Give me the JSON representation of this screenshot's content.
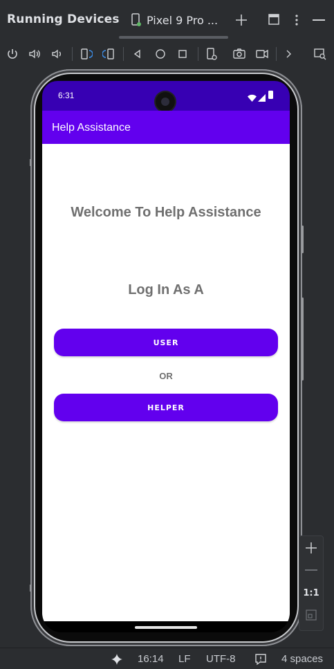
{
  "ide": {
    "panel_title": "Running Devices",
    "device_tab_label": "Pixel 9 Pro ...",
    "zoom": {
      "reset_label": "1:1"
    },
    "status": {
      "cursor": "16:14",
      "line_ending": "LF",
      "encoding": "UTF-8",
      "indent": "4 spaces"
    }
  },
  "device": {
    "status_time": "6:31"
  },
  "app": {
    "title": "Help Assistance",
    "welcome": "Welcome To Help Assistance",
    "login_prompt": "Log In As A",
    "user_button": "USER",
    "or_label": "OR",
    "helper_button": "HELPER",
    "colors": {
      "primary": "#6200ee",
      "primary_dark": "#3700b3",
      "text_gray": "#6f6f6f"
    }
  }
}
